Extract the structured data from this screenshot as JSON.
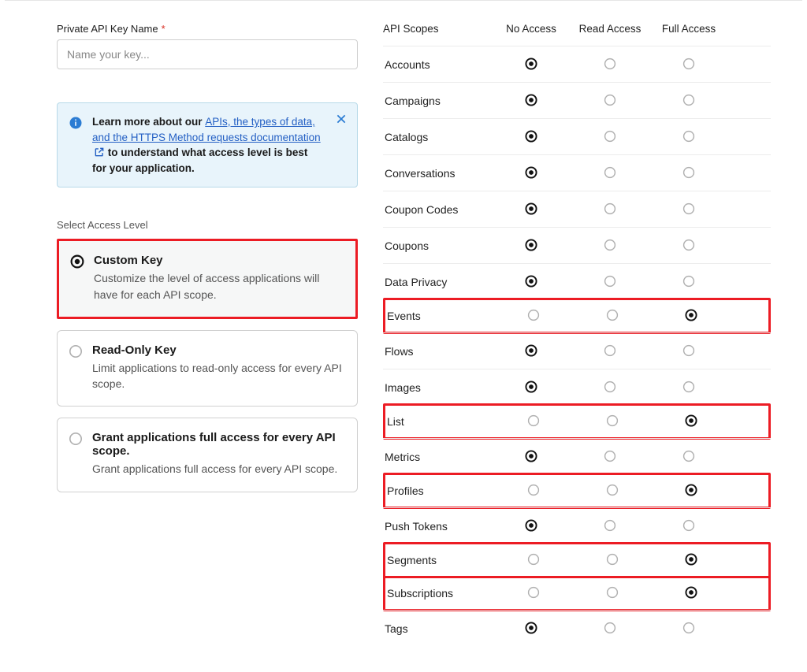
{
  "left": {
    "key_name_label": "Private API Key Name",
    "key_name_placeholder": "Name your key...",
    "info": {
      "prefix": "Learn more about our ",
      "link1": "APIs, the types of data, and the HTTPS Method requests documentation",
      "suffix": " to understand what access level is best for your application."
    },
    "section_label": "Select Access Level",
    "options": [
      {
        "title": "Custom Key",
        "desc": "Customize the level of access applications will have for each API scope.",
        "selected": true,
        "highlighted": true
      },
      {
        "title": "Read-Only Key",
        "desc": "Limit applications to read-only access for every API scope.",
        "selected": false,
        "highlighted": false
      },
      {
        "title": "Grant applications full access for every API scope.",
        "desc": "Grant applications full access for every API scope.",
        "selected": false,
        "highlighted": false
      }
    ]
  },
  "right": {
    "headers": {
      "scopes": "API Scopes",
      "none": "No Access",
      "read": "Read Access",
      "full": "Full Access"
    },
    "rows": [
      {
        "name": "Accounts",
        "sel": "none",
        "hl": false
      },
      {
        "name": "Campaigns",
        "sel": "none",
        "hl": false
      },
      {
        "name": "Catalogs",
        "sel": "none",
        "hl": false
      },
      {
        "name": "Conversations",
        "sel": "none",
        "hl": false
      },
      {
        "name": "Coupon Codes",
        "sel": "none",
        "hl": false
      },
      {
        "name": "Coupons",
        "sel": "none",
        "hl": false
      },
      {
        "name": "Data Privacy",
        "sel": "none",
        "hl": false
      },
      {
        "name": "Events",
        "sel": "full",
        "hl": true
      },
      {
        "name": "Flows",
        "sel": "none",
        "hl": false
      },
      {
        "name": "Images",
        "sel": "none",
        "hl": false
      },
      {
        "name": "List",
        "sel": "full",
        "hl": true
      },
      {
        "name": "Metrics",
        "sel": "none",
        "hl": false
      },
      {
        "name": "Profiles",
        "sel": "full",
        "hl": true
      },
      {
        "name": "Push Tokens",
        "sel": "none",
        "hl": false
      },
      {
        "name": "Segments",
        "sel": "full",
        "hl": true
      },
      {
        "name": "Subscriptions",
        "sel": "full",
        "hl": true
      },
      {
        "name": "Tags",
        "sel": "none",
        "hl": false
      }
    ]
  }
}
